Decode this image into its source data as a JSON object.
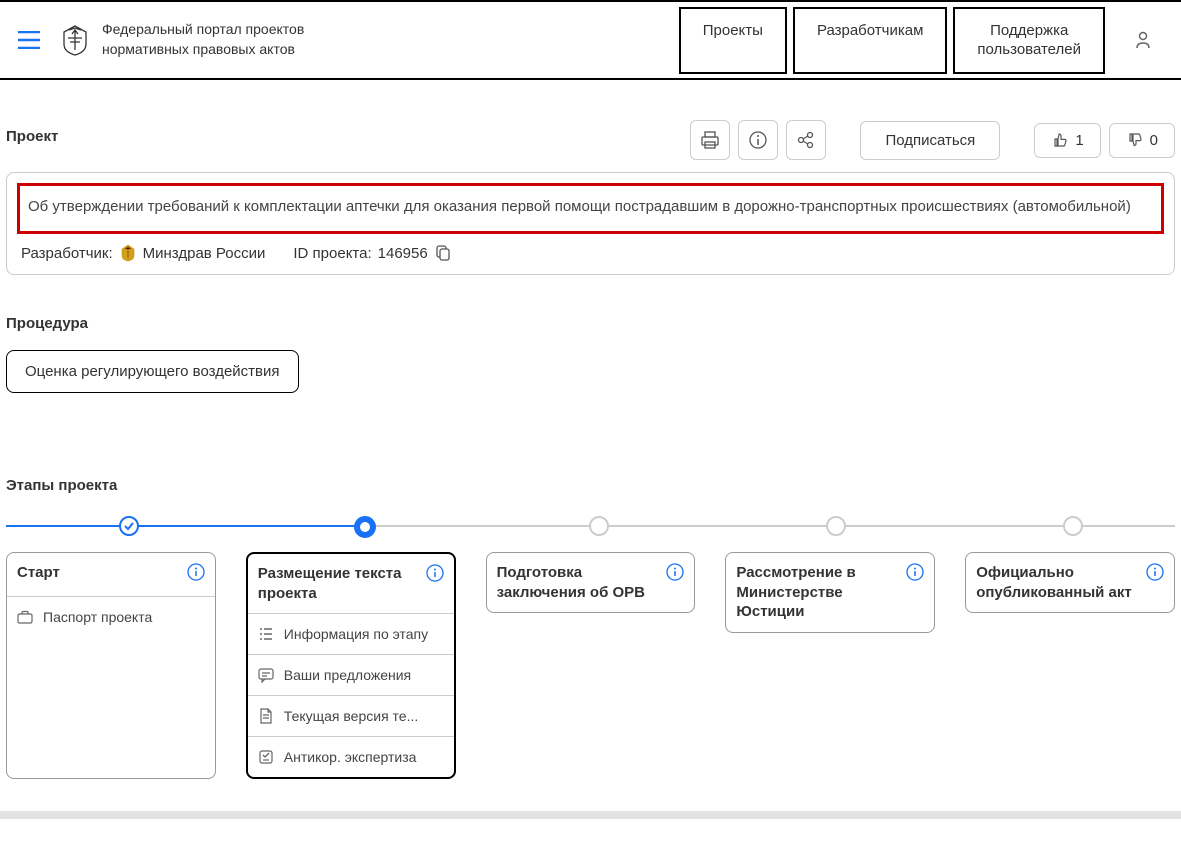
{
  "header": {
    "site_title_line1": "Федеральный портал проектов",
    "site_title_line2": "нормативных правовых актов",
    "nav": {
      "projects": "Проекты",
      "developers": "Разработчикам",
      "support_line1": "Поддержка",
      "support_line2": "пользователей"
    }
  },
  "project": {
    "section_label": "Проект",
    "subscribe_label": "Подписаться",
    "like_count": "1",
    "dislike_count": "0",
    "title": "Об утверждении требований к комплектации аптечки для оказания первой помощи пострадавшим в дорожно-транспортных происшествиях (автомобильной)",
    "developer_label": "Разработчик:",
    "developer_name": "Минздрав России",
    "id_label": "ID проекта:",
    "id_value": "146956"
  },
  "procedure": {
    "section_label": "Процедура",
    "value": "Оценка регулирующего воздействия"
  },
  "stages": {
    "section_label": "Этапы проекта",
    "items": [
      {
        "title": "Старт",
        "subs": [
          {
            "label": "Паспорт проекта"
          }
        ]
      },
      {
        "title": "Размещение текста проекта",
        "subs": [
          {
            "label": "Информация по этапу"
          },
          {
            "label": "Ваши предложения"
          },
          {
            "label": "Текущая версия те..."
          },
          {
            "label": "Антикор. экспертиза"
          }
        ]
      },
      {
        "title": "Подготовка заключения об ОРВ"
      },
      {
        "title": "Рассмотрение в Министерстве Юстиции"
      },
      {
        "title": "Официально опубликованный акт"
      }
    ]
  }
}
